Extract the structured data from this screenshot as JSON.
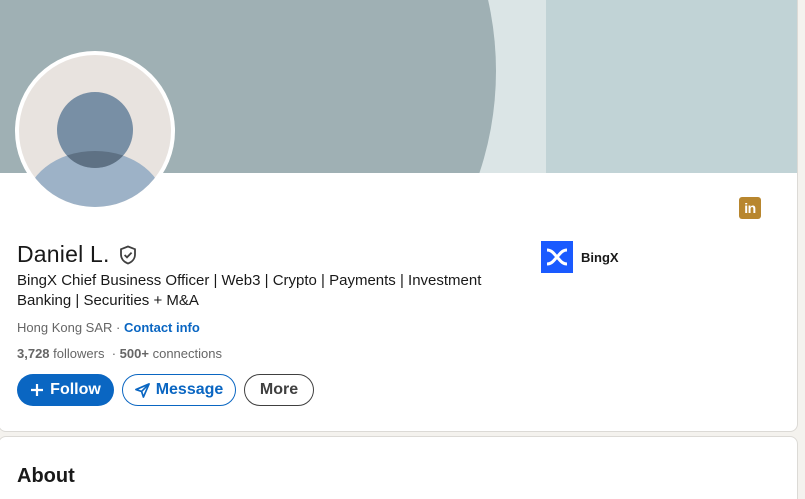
{
  "profile": {
    "name": "Daniel L.",
    "headline": "BingX Chief Business Officer | Web3 | Crypto | Payments | Investment Banking | Securities + M&A",
    "location": "Hong Kong SAR",
    "separator_dot": "·",
    "contact_info": "Contact info",
    "followers_count": "3,728",
    "followers_label": "followers",
    "connections_prefix": "·",
    "connections_count": "500+",
    "connections_label": "connections"
  },
  "company": {
    "name": "BingX",
    "logo_icon": "bingx-x-logo",
    "logo_color": "#1a5aff"
  },
  "actions": {
    "follow_label": "Follow",
    "message_label": "Message",
    "more_label": "More"
  },
  "about": {
    "title": "About"
  },
  "colors": {
    "primary": "#0a66c2",
    "linkedin_badge": "#b8862e"
  },
  "icons": {
    "verify": "verified-shield-icon",
    "linkedin": "linkedin-icon"
  }
}
